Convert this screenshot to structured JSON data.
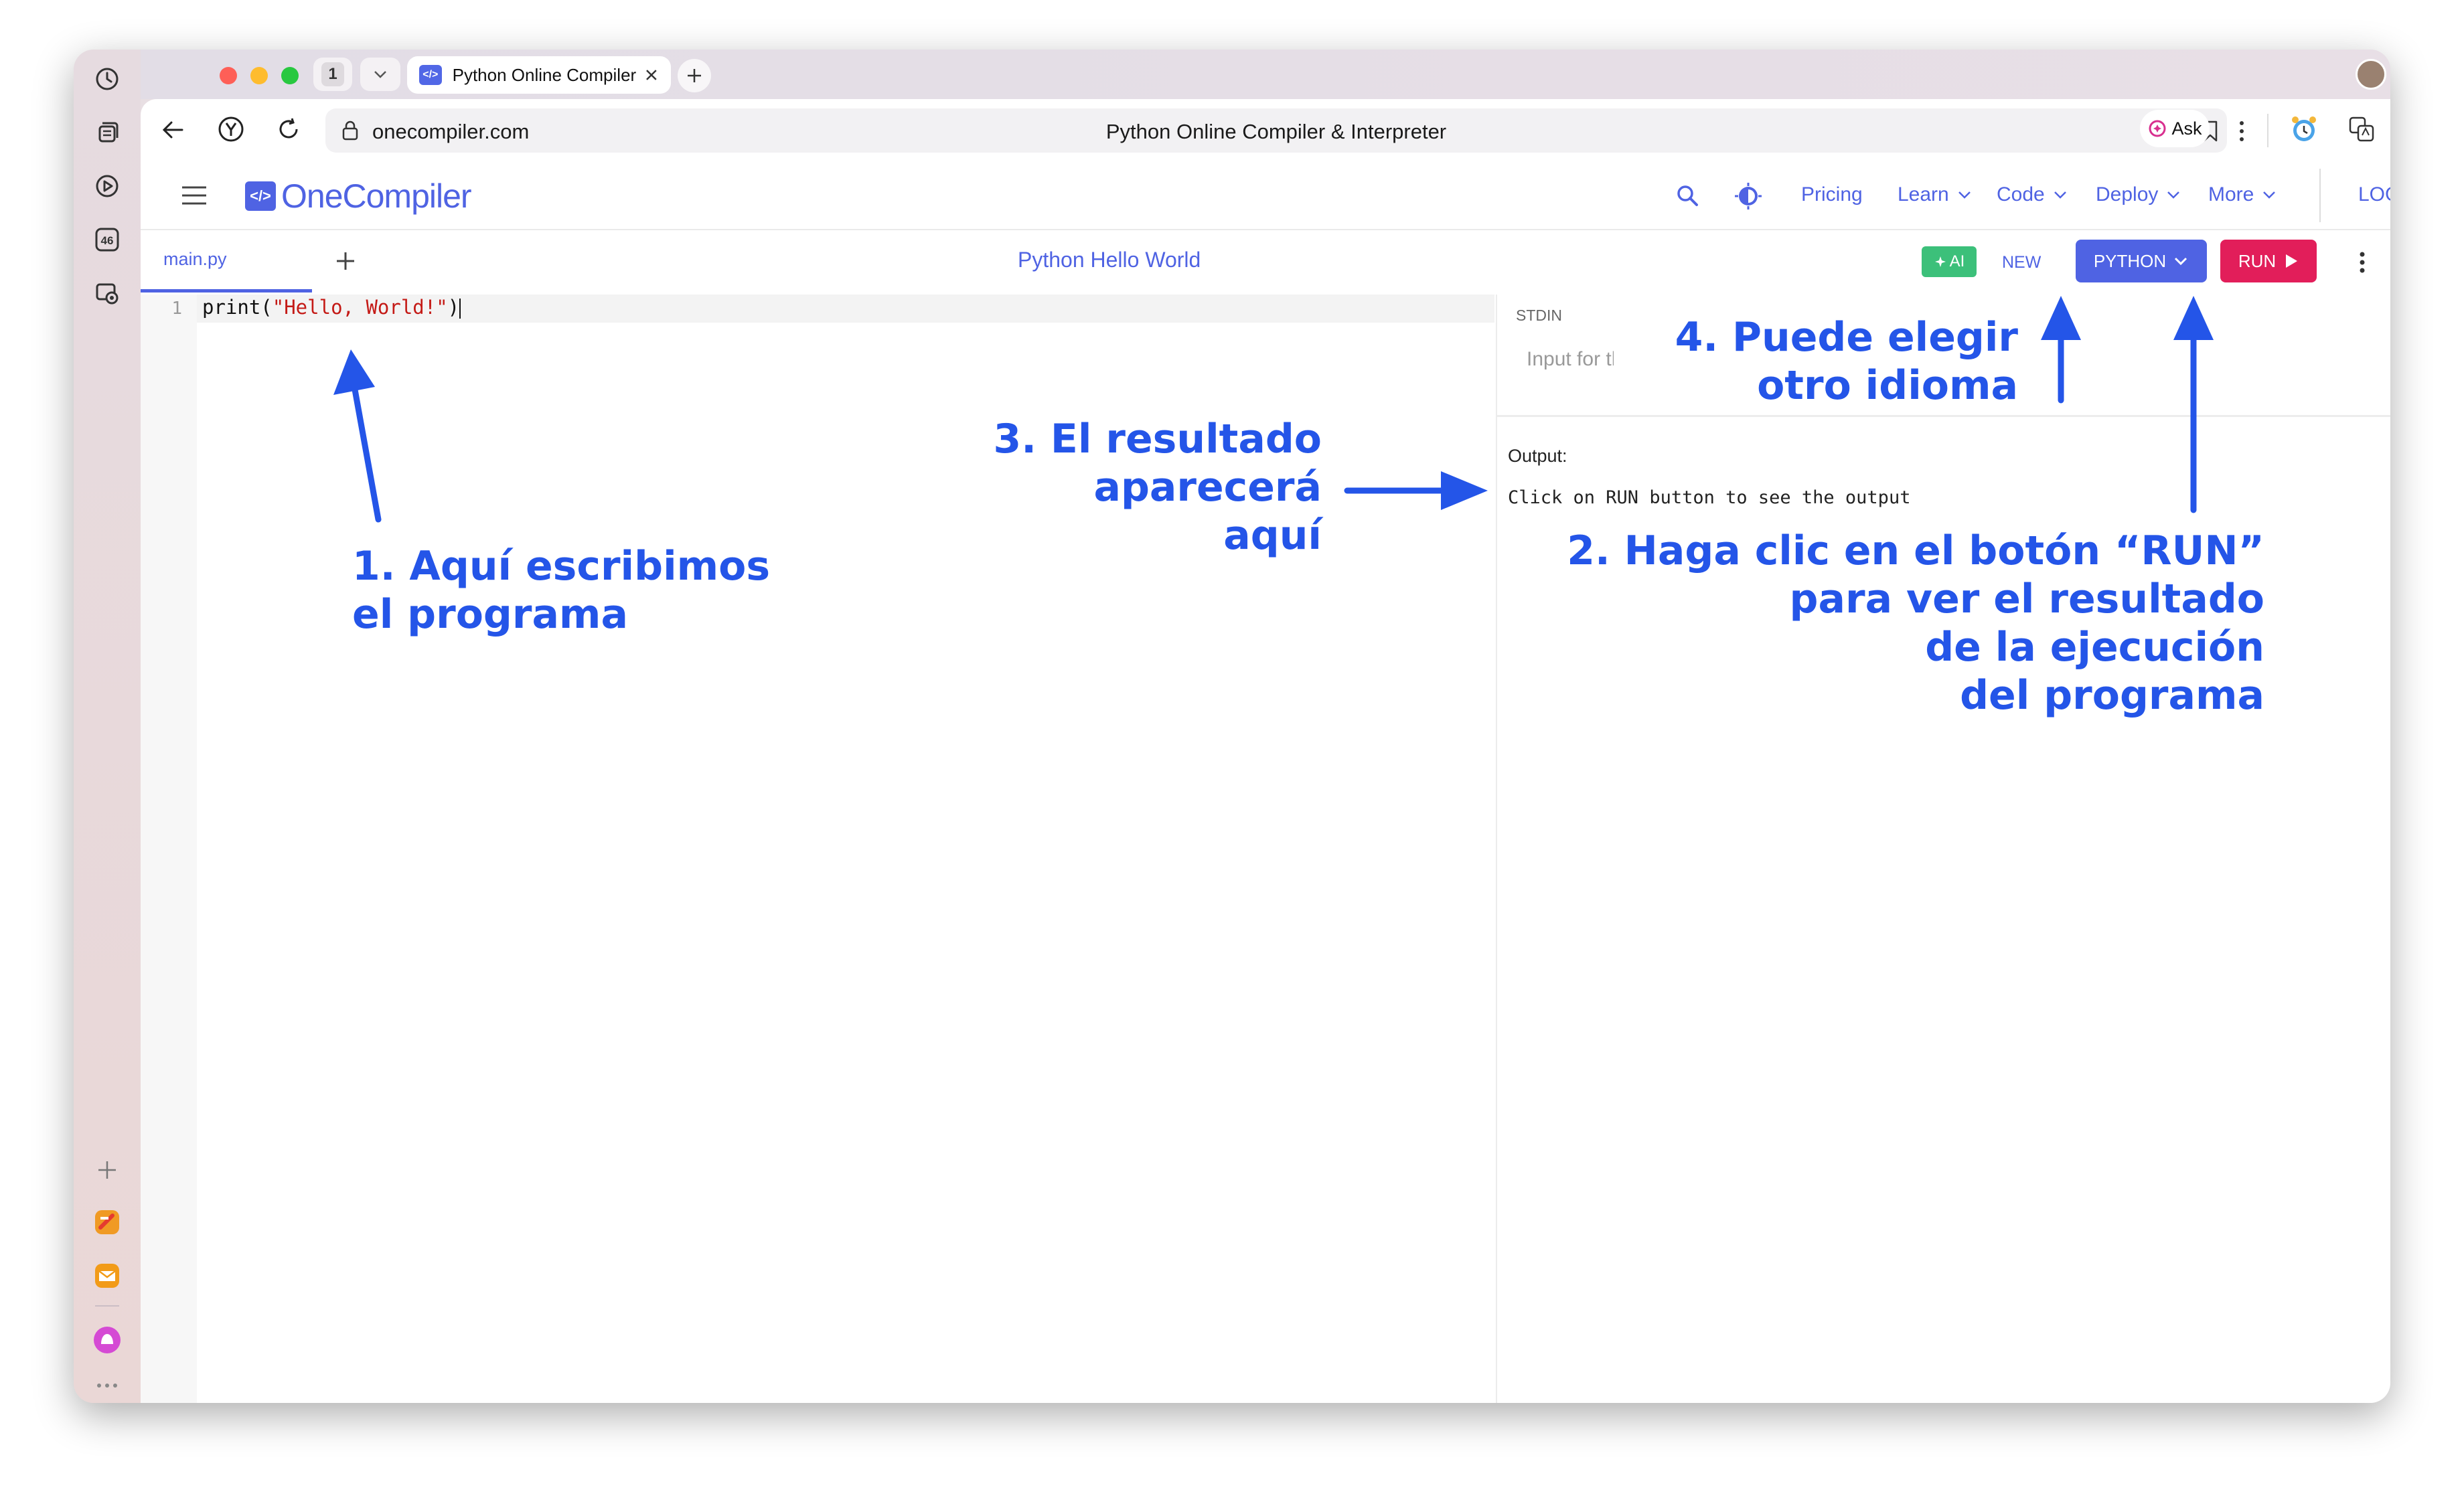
{
  "browser": {
    "tab_count": "1",
    "active_tab_title": "Python Online Compiler",
    "url": "onecompiler.com",
    "page_title": "Python Online Compiler & Interpreter",
    "ask_label": "Ask",
    "sidebar_badge": "46"
  },
  "site": {
    "logo_mark": "</>",
    "logo_text": "OneCompiler",
    "nav": {
      "pricing": "Pricing",
      "learn": "Learn",
      "code": "Code",
      "deploy": "Deploy",
      "more": "More",
      "login": "LOGIN"
    }
  },
  "ide": {
    "file_tab": "main.py",
    "title": "Python Hello World",
    "ai_label": "AI",
    "new_label": "NEW",
    "language_label": "PYTHON",
    "run_label": "RUN",
    "line_number": "1",
    "code_prefix": "print(",
    "code_string": "\"Hello, World!\"",
    "code_suffix": ")",
    "stdin_label": "STDIN",
    "stdin_placeholder": "Input for the program",
    "output_label": "Output:",
    "output_text": "Click on RUN button to see the output"
  },
  "annotations": {
    "step1": [
      "1. Aquí escribimos",
      "el programa"
    ],
    "step2": [
      "2. Haga clic en el botón “RUN”",
      "para ver el resultado",
      "de la ejecución",
      "del programa"
    ],
    "step3": [
      "3. El resultado",
      "aparecerá aquí"
    ],
    "step4": [
      "4. Puede elegir",
      "otro idioma"
    ]
  },
  "colors": {
    "brand": "#4f63e3",
    "run": "#e21e5a",
    "ai": "#3cc07a",
    "annotation": "#2455e8"
  }
}
